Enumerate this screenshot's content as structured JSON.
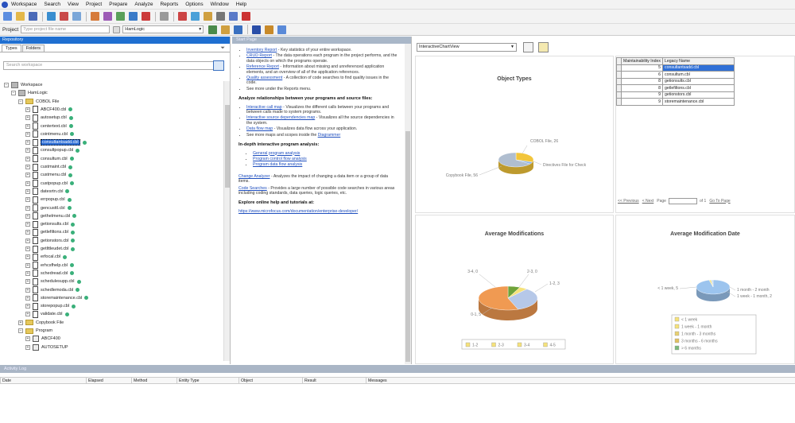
{
  "menu": [
    "Workspace",
    "Search",
    "View",
    "Project",
    "Prepare",
    "Analyze",
    "Reports",
    "Options",
    "Window",
    "Help"
  ],
  "toolbar2": {
    "project_label": "Project",
    "search_placeholder": "Type project file name",
    "project_value": "HamLogic"
  },
  "repository": {
    "title": "Repository",
    "tabs": [
      "Types",
      "Folders"
    ],
    "search_placeholder": "Search workspace",
    "tree": [
      {
        "label": "Workspace",
        "level": 0,
        "kind": "db",
        "exp": "−"
      },
      {
        "label": "HamLogic",
        "level": 1,
        "kind": "db",
        "exp": "−"
      },
      {
        "label": "COBOL File",
        "level": 2,
        "kind": "folder",
        "exp": "−"
      },
      {
        "label": "ABCF400.cbl",
        "level": 3,
        "kind": "file",
        "exp": "+",
        "dot": true
      },
      {
        "label": "autosetup.cbl",
        "level": 3,
        "kind": "file",
        "exp": "+",
        "dot": true
      },
      {
        "label": "centertext.cbl",
        "level": 3,
        "kind": "file",
        "exp": "+",
        "dot": true
      },
      {
        "label": "cointmenu.cbl",
        "level": 3,
        "kind": "file",
        "exp": "+",
        "dot": true
      },
      {
        "label": "consultantsadd.cbl",
        "level": 3,
        "kind": "file",
        "exp": "+",
        "dot": true,
        "selected": true
      },
      {
        "label": "consultpopup.cbl",
        "level": 3,
        "kind": "file",
        "exp": "+",
        "dot": true
      },
      {
        "label": "consultum.cbl",
        "level": 3,
        "kind": "file",
        "exp": "+",
        "dot": true
      },
      {
        "label": "custmaint.cbl",
        "level": 3,
        "kind": "file",
        "exp": "+",
        "dot": true
      },
      {
        "label": "custmenu.cbl",
        "level": 3,
        "kind": "file",
        "exp": "+",
        "dot": true
      },
      {
        "label": "custpopup.cbl",
        "level": 3,
        "kind": "file",
        "exp": "+",
        "dot": true
      },
      {
        "label": "datesrtn.cbl",
        "level": 3,
        "kind": "file",
        "exp": "+",
        "dot": true
      },
      {
        "label": "errpopup.cbl",
        "level": 3,
        "kind": "file",
        "exp": "+",
        "dot": true
      },
      {
        "label": "gencusttl.cbl",
        "level": 3,
        "kind": "file",
        "exp": "+",
        "dot": true
      },
      {
        "label": "gethelmenu.cbl",
        "level": 3,
        "kind": "file",
        "exp": "+",
        "dot": true
      },
      {
        "label": "getionsults.cbl",
        "level": 3,
        "kind": "file",
        "exp": "+",
        "dot": true
      },
      {
        "label": "getlefiltons.cbl",
        "level": 3,
        "kind": "file",
        "exp": "+",
        "dot": true
      },
      {
        "label": "getionstors.cbl",
        "level": 3,
        "kind": "file",
        "exp": "+",
        "dot": true
      },
      {
        "label": "getlttleudet.cbl",
        "level": 3,
        "kind": "file",
        "exp": "+",
        "dot": true
      },
      {
        "label": "erfocal.cbl",
        "level": 3,
        "kind": "file",
        "exp": "+",
        "dot": true
      },
      {
        "label": "erhcsfhelp.cbl",
        "level": 3,
        "kind": "file",
        "exp": "+",
        "dot": true
      },
      {
        "label": "schedread.cbl",
        "level": 3,
        "kind": "file",
        "exp": "+",
        "dot": true
      },
      {
        "label": "schedulesupp.cbl",
        "level": 3,
        "kind": "file",
        "exp": "+",
        "dot": true
      },
      {
        "label": "schedlemoda.cbl",
        "level": 3,
        "kind": "file",
        "exp": "+",
        "dot": true
      },
      {
        "label": "storemaintenance.cbl",
        "level": 3,
        "kind": "file",
        "exp": "+",
        "dot": true
      },
      {
        "label": "storepopup.cbl",
        "level": 3,
        "kind": "file",
        "exp": "+",
        "dot": true
      },
      {
        "label": "validate.cbl",
        "level": 3,
        "kind": "file",
        "exp": "+",
        "dot": true
      },
      {
        "label": "Copybook File",
        "level": 2,
        "kind": "folder",
        "exp": "+"
      },
      {
        "label": "Program",
        "level": 2,
        "kind": "folder",
        "exp": "−"
      },
      {
        "label": "ABCF400",
        "level": 3,
        "kind": "prog",
        "exp": "+"
      },
      {
        "label": "AUTOSETUP",
        "level": 3,
        "kind": "prog",
        "exp": "+"
      }
    ]
  },
  "startpage": {
    "title": "Start Page",
    "list1": [
      {
        "link": "Inventory Report",
        "text": " - Key statistics of your entire workspace."
      },
      {
        "link": "CRUD Report",
        "text": " - The data operations each program in the project performs, and the data objects on which the programs operate."
      },
      {
        "link": "Reference Report",
        "text": " - Information about missing and unreferenced application elements, and an overview of all of the application references."
      },
      {
        "link": "Quality assessment",
        "text": " - A collection of code searches to find quality issues in the code."
      },
      {
        "link": "",
        "text": "See more under the Reports menu."
      }
    ],
    "heading2": "Analyze relationships between your programs and source files:",
    "list2": [
      {
        "link": "Interactive call map",
        "text": " - Visualizes the different calls between your programs and between calls made to system programs."
      },
      {
        "link": "Interactive source dependencies map",
        "text": " - Visualizes all the source dependencies in the system."
      },
      {
        "link": "Data flow map",
        "text": " - Visualizes data flow across your application."
      },
      {
        "link": "Diagrammer",
        "text": "See more maps and scopes inside the "
      }
    ],
    "heading3": "In-depth interactive program analysis:",
    "list3": [
      "General program analysis",
      "Program control flow analysis",
      "Program data flow analysis"
    ],
    "para1_link": "Change Analyzer",
    "para1_text": " - Analyzes the impact of changing a data item or a group of data items.",
    "para2_link": "Code Searches",
    "para2_text": " - Provides a large number of possible code searches in various areas including coding standards, data queries, logic queries, etc.",
    "heading4": "Explore online help and tutorials at:",
    "help_link": "https://www.microfocus.com/documentation/enterprise-developer/"
  },
  "chart_view": {
    "select_value": "InteractiveChartView"
  },
  "chart_data": [
    {
      "type": "pie",
      "title": "Object Types",
      "labels": [
        "COBOL File, 26",
        "Directives File for Check",
        "Copybook File, 56"
      ],
      "values": [
        26,
        4,
        56
      ],
      "colors": [
        "#f2c53b",
        "#8ab2e8",
        "#b0bed0"
      ]
    },
    {
      "type": "pie",
      "title": "Average Modifications",
      "labels": [
        "3-4, 0",
        "2-3, 0",
        "1-2, 3",
        "0-1, 5"
      ],
      "values": [
        0.6,
        0.4,
        3,
        5
      ],
      "colors": [
        "#6fa33a",
        "#f6e27a",
        "#b6c8e8",
        "#f09a52"
      ],
      "legend": [
        "1-2",
        "2-3",
        "3-4",
        "4-5"
      ]
    },
    {
      "type": "pie",
      "title": "Average Modification Date",
      "labels": [
        "< 1 week, 5",
        "1 month - 2 month",
        "1 week - 1 month, 2"
      ],
      "values": [
        5,
        0.1,
        0.1
      ],
      "colors": [
        "#9cc4ee",
        "#f6e27a",
        "#c9dcf0"
      ],
      "legend": [
        "< 1 week",
        "1 week - 1 month",
        "1 month - 3 months",
        "3 months - 6 months",
        "> 6 months"
      ]
    },
    {
      "type": "table",
      "columns": [
        "Maintainability Index",
        "Legacy Name"
      ],
      "rows": [
        [
          "5",
          "consultantsadd.cbl"
        ],
        [
          "6",
          "consultum.cbl"
        ],
        [
          "8",
          "getionsults.cbl"
        ],
        [
          "8",
          "getlefiltons.cbl"
        ],
        [
          "9",
          "getionstors.cbl"
        ],
        [
          "9",
          "storemaintenance.cbl"
        ]
      ]
    }
  ],
  "grid_pager": {
    "first": "<< Previous",
    "prev": "< Next",
    "page_label": "Page",
    "of_label": "of 1",
    "goto": "Go To Page"
  },
  "bottom": {
    "title": "Activity Log",
    "columns": [
      "Date",
      "Elapsed",
      "Method",
      "Entity Type",
      "Object",
      "Result",
      "Messages"
    ]
  }
}
